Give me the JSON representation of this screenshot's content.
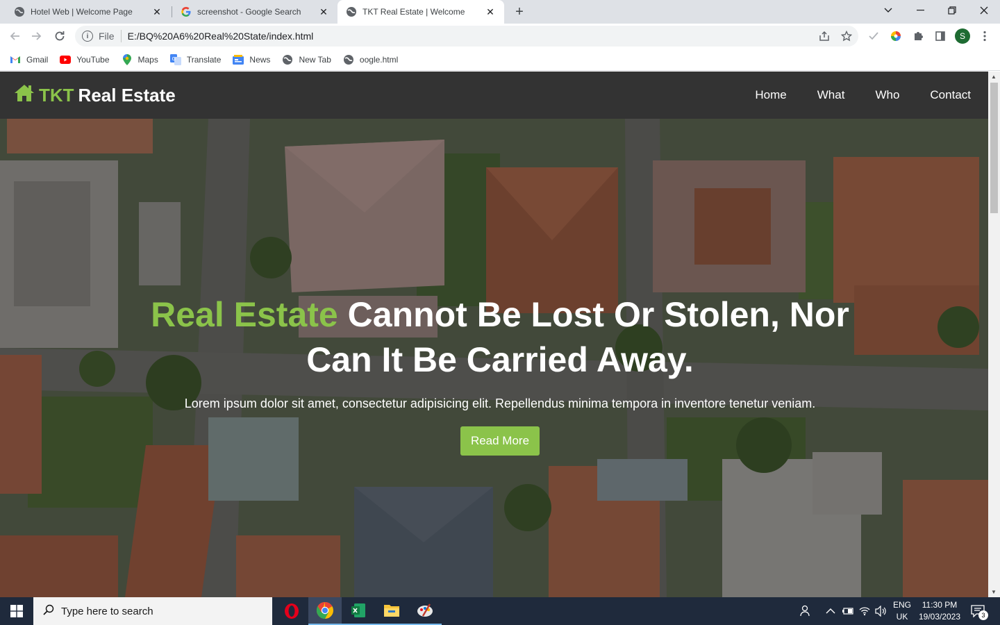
{
  "browser": {
    "tabs": [
      {
        "title": "Hotel Web | Welcome Page",
        "favicon": "globe-icon",
        "active": false
      },
      {
        "title": "screenshot - Google Search",
        "favicon": "google-icon",
        "active": false
      },
      {
        "title": "TKT Real Estate | Welcome",
        "favicon": "globe-icon",
        "active": true
      }
    ],
    "new_tab": "+",
    "address": {
      "scheme_label": "File",
      "url": "E:/BQ%20A6%20Real%20State/index.html"
    },
    "profile_initial": "S",
    "bookmarks": [
      {
        "label": "Gmail",
        "icon": "gmail-icon"
      },
      {
        "label": "YouTube",
        "icon": "youtube-icon"
      },
      {
        "label": "Maps",
        "icon": "maps-icon"
      },
      {
        "label": "Translate",
        "icon": "translate-icon"
      },
      {
        "label": "News",
        "icon": "news-icon"
      },
      {
        "label": "New Tab",
        "icon": "globe-icon"
      },
      {
        "label": "oogle.html",
        "icon": "globe-icon"
      }
    ]
  },
  "site": {
    "logo_brand": "TKT",
    "logo_rest": "Real Estate",
    "nav": [
      "Home",
      "What",
      "Who",
      "Contact"
    ],
    "hero": {
      "title_highlight": "Real Estate",
      "title_rest": "Cannot Be Lost Or Stolen, Nor Can It Be Carried Away.",
      "subtitle": "Lorem ipsum dolor sit amet, consectetur adipisicing elit. Repellendus minima tempora in inventore tenetur veniam.",
      "button": "Read More"
    },
    "colors": {
      "accent": "#8bc34a",
      "nav_bg": "#333333"
    }
  },
  "taskbar": {
    "search_placeholder": "Type here to search",
    "apps": [
      "opera-icon",
      "chrome-icon",
      "excel-icon",
      "file-explorer-icon",
      "paint-icon"
    ],
    "lang_line1": "ENG",
    "lang_line2": "UK",
    "time": "11:30 PM",
    "date": "19/03/2023",
    "notification_count": "3"
  }
}
